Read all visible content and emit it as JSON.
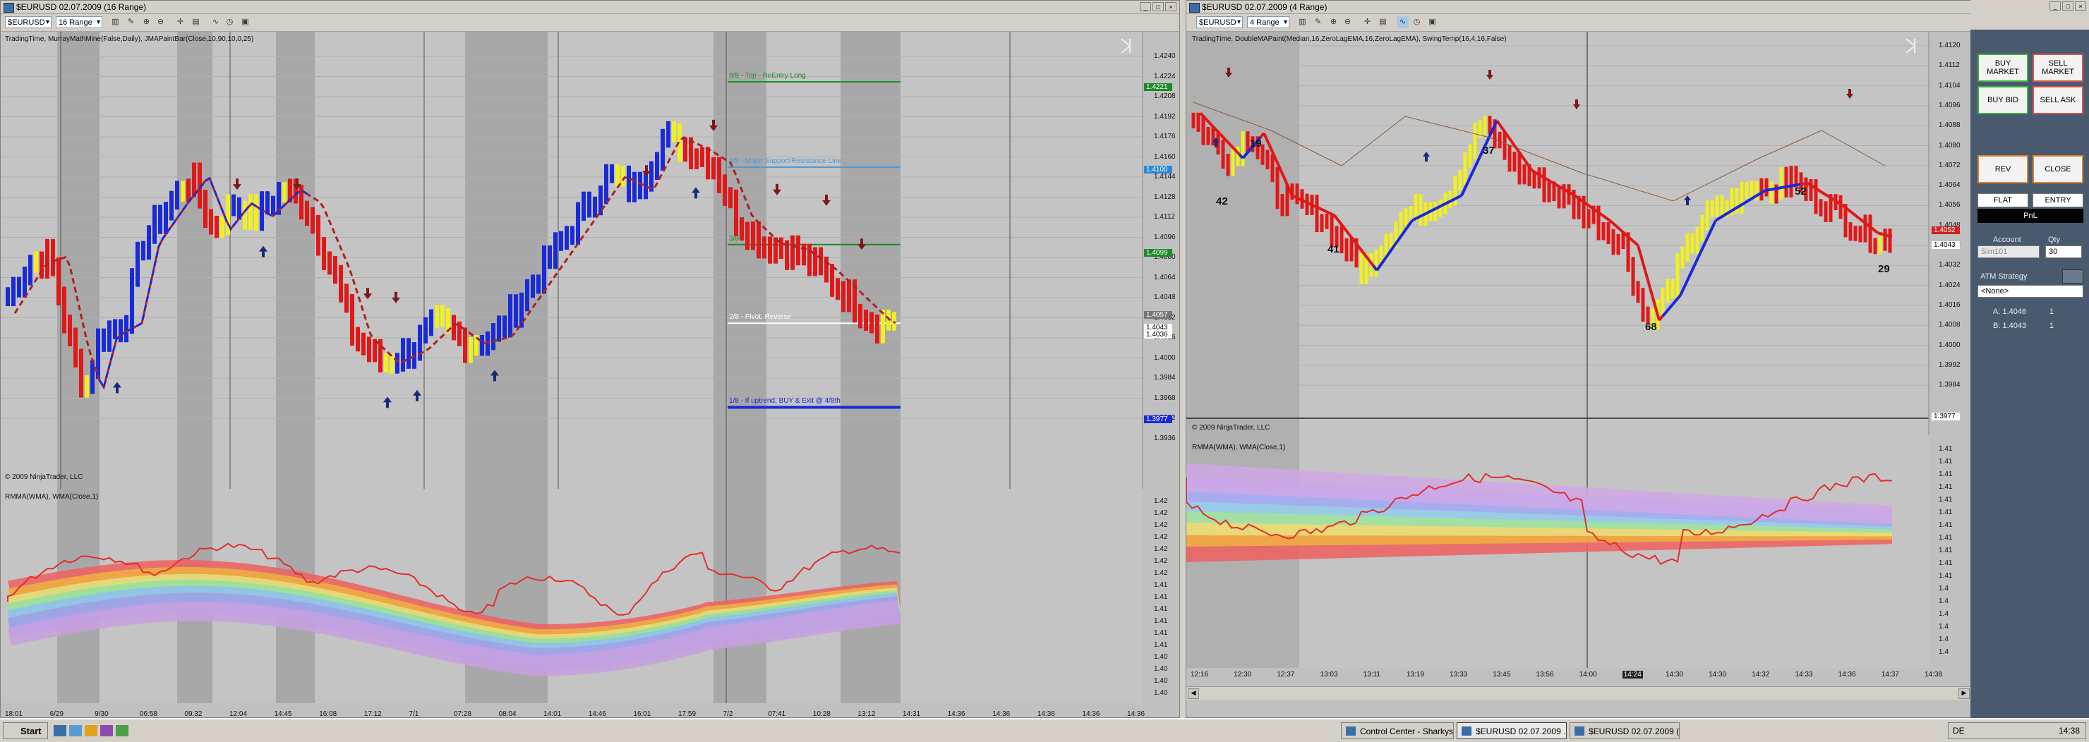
{
  "left_window": {
    "title": "$EURUSD  02.07.2009  (16 Range)",
    "instrument": "$EURUSD",
    "period": "16 Range",
    "indicators_label": "TradingTime, MurrayMathMine(False,Daily), JMAPaintBar(Close,10,90,10,0,25)",
    "copyright": "© 2009 NinjaTrader, LLC",
    "lower_label": "RMMA(WMA), WMA(Close,1)",
    "price_ticks": [
      "1.4240",
      "1.4224",
      "1.4208",
      "1.4192",
      "1.4176",
      "1.4160",
      "1.4144",
      "1.4128",
      "1.4112",
      "1.4096",
      "1.4080",
      "1.4064",
      "1.4048",
      "1.4032",
      "1.4016",
      "1.4000",
      "1.3984",
      "1.3968",
      "1.3952",
      "1.3936"
    ],
    "price_badges": [
      {
        "text": "1.4221",
        "color": "#1f8a2a"
      },
      {
        "text": "1.4100",
        "color": "#2a8ad0"
      },
      {
        "text": "1.4099",
        "color": "#1f8a2a"
      },
      {
        "text": "1.4057",
        "color": "#777777"
      },
      {
        "text": "1.4043",
        "color": "#ffffff"
      },
      {
        "text": "1.4036",
        "color": "#ffffff"
      },
      {
        "text": "1.3977",
        "color": "#1a2ad8"
      }
    ],
    "murray_lines": [
      {
        "label": "8/8 - Top - ReEntry Long",
        "color": "#1f8a2a",
        "price": 1.4221
      },
      {
        "label": "4/8 - Major Support/Resistance Line",
        "color": "#4a9ad8",
        "price": 1.4157
      },
      {
        "label": "3/8 - ...",
        "color": "#1f8a2a",
        "price": 1.4099
      },
      {
        "label": "2/8 - Pivot, Reverse",
        "color": "#ffffff",
        "price": 1.404
      },
      {
        "label": "1/8 - If uptrend, BUY & Exit @ 4/8th",
        "color": "#1a2ad8",
        "price": 1.3977
      }
    ],
    "lower_ticks": [
      "1.42",
      "1.42",
      "1.42",
      "1.42",
      "1.42",
      "1.42",
      "1.42",
      "1.41",
      "1.41",
      "1.41",
      "1.41",
      "1.41",
      "1.41",
      "1.40",
      "1.40",
      "1.40",
      "1.40"
    ],
    "time_ticks": [
      "18:01",
      "6/29",
      "9/30",
      "06:58",
      "09:32",
      "12:04",
      "14:45",
      "16:08",
      "17:12",
      "7/1",
      "07:28",
      "08:04",
      "14:01",
      "14:46",
      "16:01",
      "17:59",
      "7/2",
      "07:41",
      "10:28",
      "13:12",
      "14:31",
      "14:36",
      "14:36",
      "14:36",
      "14:36",
      "14:36"
    ]
  },
  "right_window": {
    "title": "$EURUSD  02.07.2009  (4 Range)",
    "instrument": "$EURUSD",
    "period": "4 Range",
    "indicators_label": "TradingTime, DoubleMAPaint(Median,16,ZeroLagEMA,16,ZeroLagEMA), SwingTemp(16,4,16,False)",
    "copyright": "© 2009 NinjaTrader, LLC",
    "lower_label": "RMMA(WMA), WMA(Close,1)",
    "price_ticks": [
      "1.4120",
      "1.4112",
      "1.4104",
      "1.4096",
      "1.4088",
      "1.4080",
      "1.4072",
      "1.4064",
      "1.4056",
      "1.4048",
      "1.4040",
      "1.4032",
      "1.4024",
      "1.4016",
      "1.4008",
      "1.4000",
      "1.3992",
      "1.3984"
    ],
    "price_badges": [
      {
        "text": "1.4052",
        "color": "#d02020"
      },
      {
        "text": "1.4043",
        "color": "#ffffff"
      },
      {
        "text": "1.3977",
        "color": "#ffffff"
      }
    ],
    "swing_labels": [
      "42",
      "19",
      "41",
      "37",
      "68",
      "52",
      "29"
    ],
    "crosshair_time": "14:24",
    "lower_ticks": [
      "1.41",
      "1.41",
      "1.41",
      "1.41",
      "1.41",
      "1.41",
      "1.41",
      "1.41",
      "1.41",
      "1.41",
      "1.41",
      "1.4",
      "1.4",
      "1.4",
      "1.4",
      "1.4",
      "1.4"
    ],
    "time_ticks": [
      "12:16",
      "12:30",
      "12:37",
      "13:03",
      "13:11",
      "13:19",
      "13:33",
      "13:45",
      "13:56",
      "14:00",
      "14:24",
      "14:30",
      "14:30",
      "14:32",
      "14:33",
      "14:36",
      "14:37",
      "14:38"
    ]
  },
  "order_panel": {
    "buy_market": "BUY MARKET",
    "sell_market": "SELL MARKET",
    "buy_bid": "BUY BID",
    "sell_ask": "SELL ASK",
    "rev": "REV",
    "close": "CLOSE",
    "flat": "FLAT",
    "entry": "ENTRY",
    "pnl": "PnL",
    "account_label": "Account",
    "account_value": "Sim101",
    "qty_label": "Qty",
    "qty_value": "30",
    "atm_label": "ATM Strategy",
    "atm_value": "<None>",
    "a_label": "A: 1.4046",
    "a_qty": "1",
    "b_label": "B: 1.4043",
    "b_qty": "1"
  },
  "taskbar": {
    "start": "Start",
    "tasks": [
      "Control Center - Sharkys...",
      "$EURUSD  02.07.2009 ...",
      "$EURUSD  02.07.2009 (..."
    ],
    "lang": "DE",
    "clock": "14:38"
  }
}
